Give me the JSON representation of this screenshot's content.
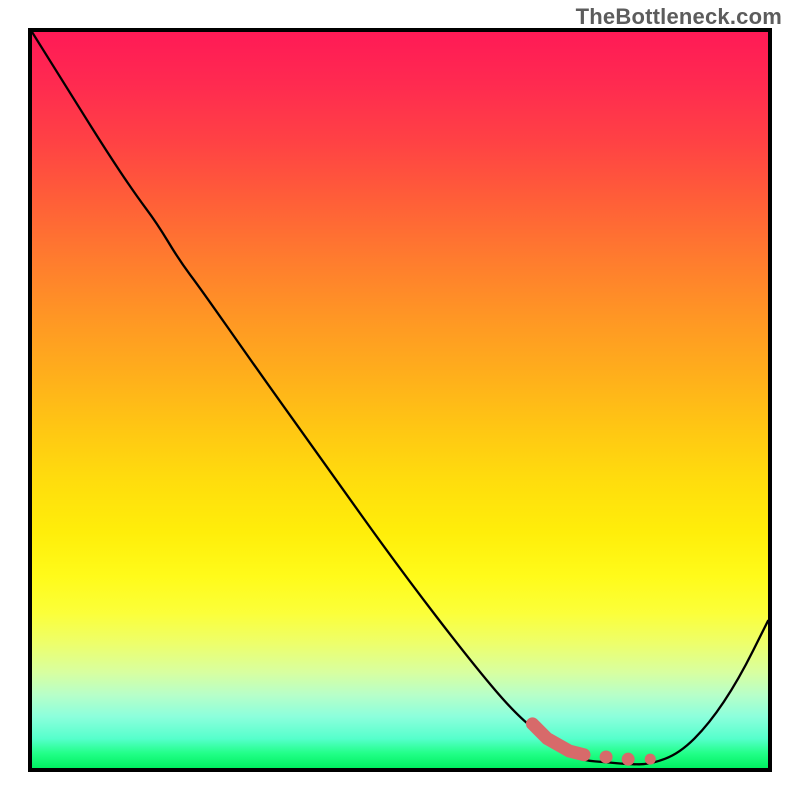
{
  "attribution": "TheBottleneck.com",
  "chart_data": {
    "type": "line",
    "title": "",
    "xlabel": "",
    "ylabel": "",
    "xlim": [
      0,
      100
    ],
    "ylim": [
      0,
      100
    ],
    "grid": false,
    "legend": false,
    "series": [
      {
        "name": "bottleneck-curve",
        "x": [
          0,
          5,
          10,
          14,
          17,
          20,
          23,
          30,
          40,
          50,
          60,
          66,
          70,
          73,
          75,
          78,
          81,
          84,
          88,
          92,
          96,
          100
        ],
        "y": [
          100,
          92,
          84,
          78,
          74,
          69,
          65,
          55,
          41,
          27,
          14,
          7,
          4,
          2,
          1,
          0.8,
          0.5,
          0.5,
          2,
          6,
          12,
          20
        ]
      },
      {
        "name": "highlight-segment",
        "style": "thick-dotted",
        "color": "#d76a6a",
        "x": [
          68,
          70,
          73,
          75,
          78,
          81,
          84
        ],
        "y": [
          6,
          4,
          2.3,
          1.8,
          1.5,
          1.2,
          1.2
        ]
      }
    ],
    "annotations": []
  },
  "colors": {
    "border": "#000000",
    "highlight": "#d76a6a",
    "gradient_top": "#ff1a56",
    "gradient_bottom": "#00f060"
  }
}
